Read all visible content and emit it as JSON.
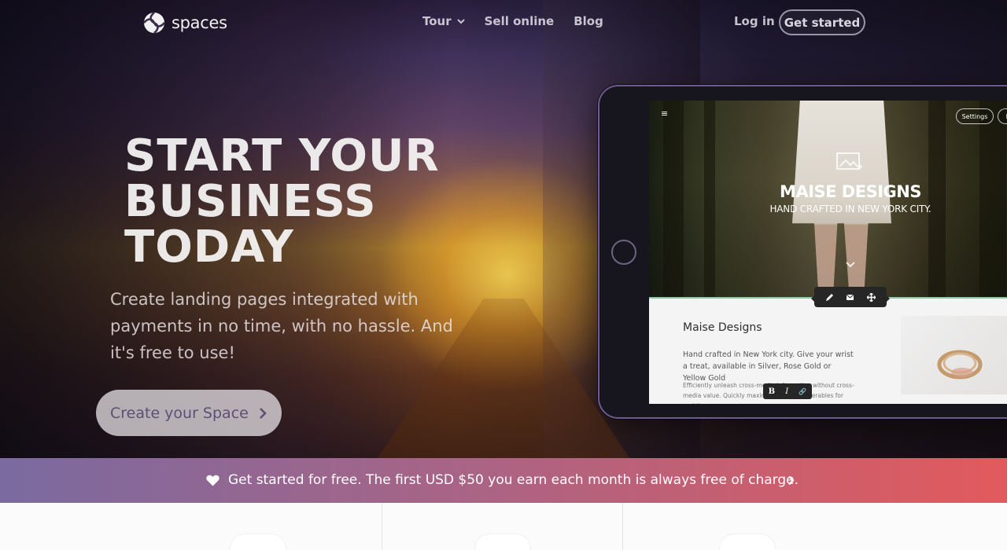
{
  "brand": {
    "name": "spaces"
  },
  "nav": {
    "items": [
      {
        "label": "Tour",
        "has_dropdown": true
      },
      {
        "label": "Sell online",
        "has_dropdown": false
      },
      {
        "label": "Blog",
        "has_dropdown": false
      }
    ],
    "login_label": "Log in",
    "get_started_label": "Get started"
  },
  "hero": {
    "headline": "START YOUR BUSINESS TODAY",
    "subline": "Create landing pages integrated with payments in no time, with no hassle. And it's free to use!",
    "cta_label": "Create your Space",
    "cta_icon": "chevron-right-icon"
  },
  "tablet_preview": {
    "menu_glyph": "≡",
    "settings_label": "Settings",
    "extra_pill_label": "P",
    "site_name": "MAISE DESIGNS",
    "site_tagline": "HAND CRAFTED IN NEW YORK CITY.",
    "section_title": "Maise Designs",
    "section_body": "Hand crafted in New York city. Give your wrist a treat, available in Silver, Rose Gold or Yellow Gold",
    "section_body2": "Efficiently unleash cross-media information without cross-media value. Quickly maximize timely deliverables for real-time",
    "format_buttons": [
      "B",
      "I",
      "🔗"
    ],
    "toolbar_icons": [
      "pencil-icon",
      "envelope-icon",
      "move-icon"
    ]
  },
  "promo": {
    "text": "Get started for free. The first USD $50 you earn each month is always free of charge.",
    "icon": "heart-icon"
  },
  "colors": {
    "accent_purple": "#5c4f78",
    "banner_start": "#7a6aa0",
    "banner_end": "#e25a5c"
  }
}
